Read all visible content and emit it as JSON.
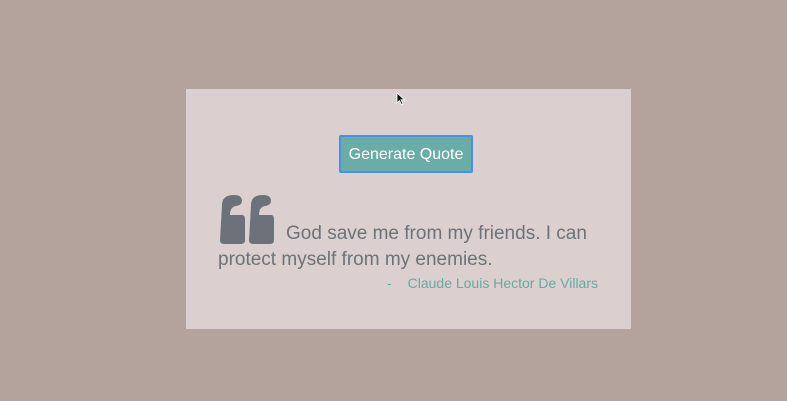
{
  "button": {
    "label": "Generate Quote"
  },
  "quote": {
    "text": "God save me from my friends. I can protect myself from my enemies.",
    "author_dash": "-",
    "author": "Claude Louis Hector De Villars",
    "mark_icon": "quote-icon"
  },
  "colors": {
    "background": "#b3a39c",
    "card": "#dbd0cf",
    "button": "#69ada6",
    "button_border": "#4a8fe8",
    "quote_text": "#6d727a",
    "author": "#66aaa4"
  }
}
